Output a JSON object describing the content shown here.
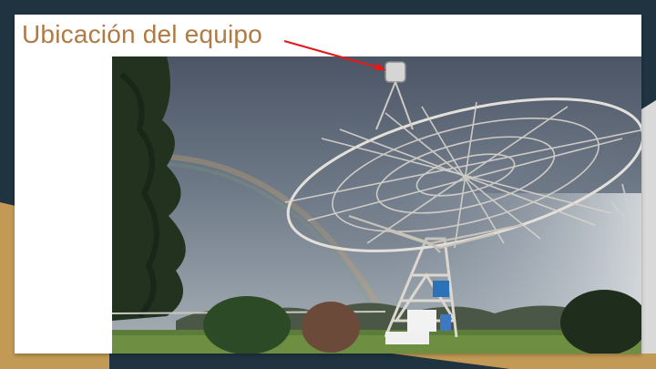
{
  "slide": {
    "title": "Ubicación del equipo"
  },
  "photo": {
    "subject": "radio-telescope-dish",
    "annotation": "arrow-to-equipment"
  },
  "colors": {
    "background_dark": "#1f3440",
    "background_gold": "#c29a55",
    "title": "#b07a45",
    "arrow": "#e11b1b"
  }
}
